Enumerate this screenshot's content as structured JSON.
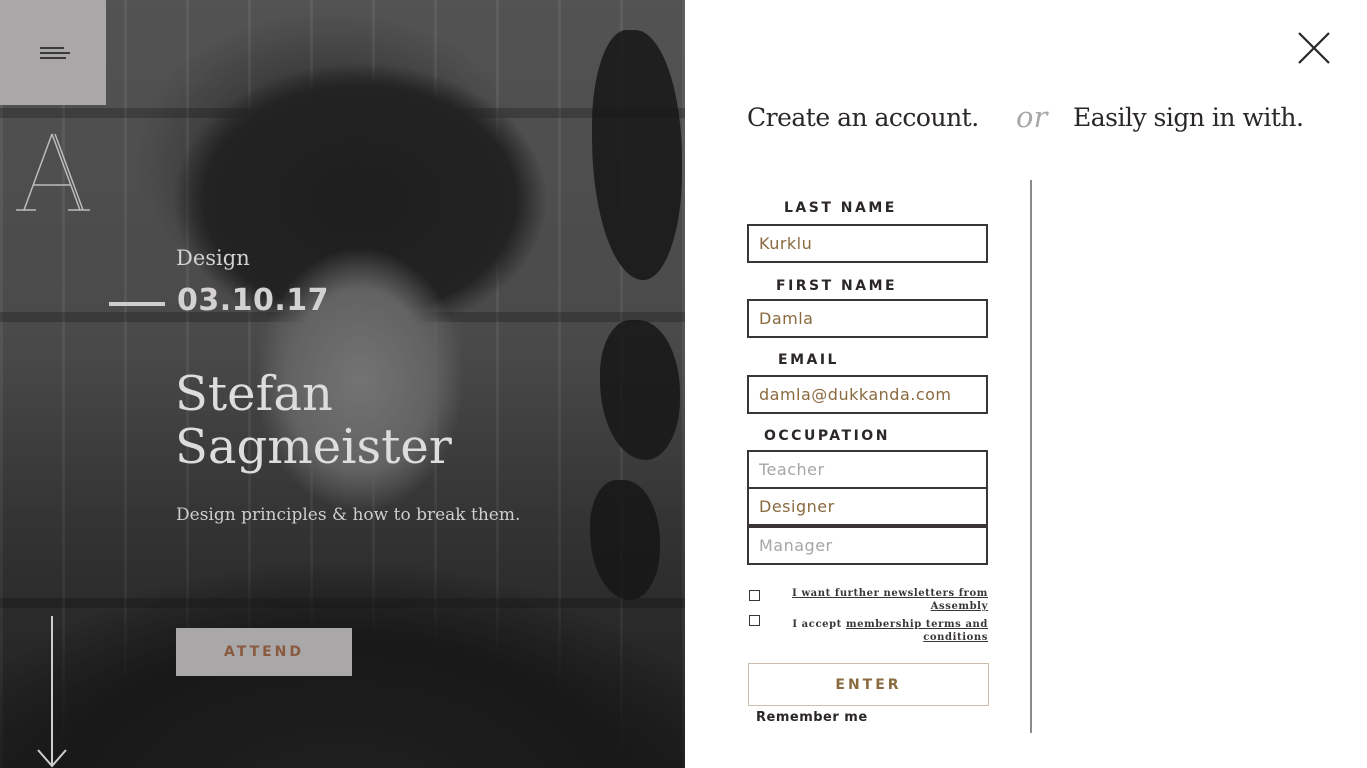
{
  "hero": {
    "category": "Design",
    "date": "03.10.17",
    "speaker_first": "Stefan",
    "speaker_last": "Sagmeister",
    "tagline": "Design principles & how to break them.",
    "attend_label": "ATTEND",
    "photo_tone": "#5c5c5c",
    "menu_bg": "#a9a7a8"
  },
  "icons": {
    "menu": "menu-icon",
    "logo": "logo-a-icon",
    "scroll": "arrow-down-icon",
    "close": "close-icon"
  },
  "form": {
    "heading_create": "Create an account.",
    "heading_or": "or",
    "heading_social": "Easily sign in with.",
    "last_name_label": "LAST NAME",
    "last_name_value": "Kurklu",
    "first_name_label": "FIRST NAME",
    "first_name_value": "Damla",
    "email_label": "EMAIL",
    "email_value": "damla@dukkanda.com",
    "occupation_label": "OCCUPATION",
    "occupation_options": [
      "Teacher",
      "Designer",
      "Manager"
    ],
    "occupation_selected": "Designer",
    "newsletter_text": "I want further newsletters from Assembly",
    "terms_prefix": "I accept ",
    "terms_link": "membership terms and conditions",
    "enter_label": "ENTER",
    "remember_label": "Remember me",
    "accent_color": "#8a6a3f"
  }
}
